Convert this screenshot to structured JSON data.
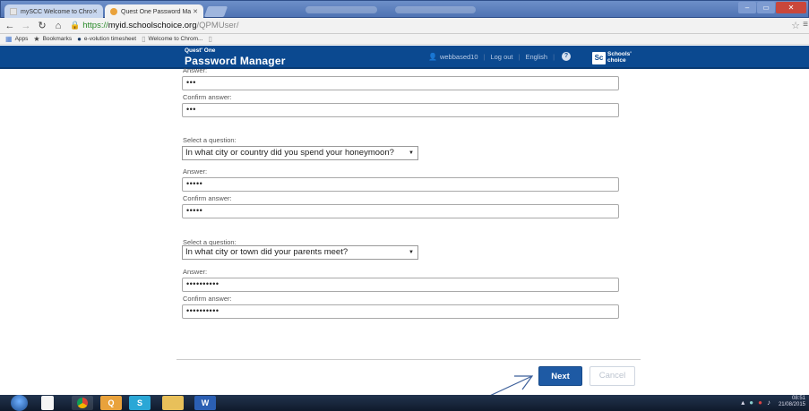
{
  "browser": {
    "tabs": [
      {
        "label": "mySCC Welcome to Chro",
        "active": false
      },
      {
        "label": "Quest One Password Ma",
        "active": true
      }
    ],
    "url": {
      "scheme": "https://",
      "host": "myid.schoolschoice.org",
      "path": "/QPMUser/"
    },
    "bookmarks": [
      {
        "label": "Apps",
        "icon": "apps-grid-icon"
      },
      {
        "label": "Bookmarks",
        "icon": "star-icon"
      },
      {
        "label": "e-volution timesheet",
        "icon": "evolution-icon"
      },
      {
        "label": "Welcome to Chrom...",
        "icon": "page-icon"
      }
    ]
  },
  "header": {
    "brand_small": "Quest' One",
    "brand_big": "Password Manager",
    "username": "webbased10",
    "logout": "Log out",
    "language": "English",
    "logo_box": "Sc",
    "logo_line1": "Schools'",
    "logo_line2": "choice",
    "accent_color": "#0b4990"
  },
  "form": {
    "group1": {
      "answer_label": "Answer:",
      "answer_value": "•••",
      "confirm_label": "Confirm answer:",
      "confirm_value": "•••"
    },
    "group2": {
      "question_label": "Select a question:",
      "question_value": "In what city or country did you spend your honeymoon?",
      "answer_label": "Answer:",
      "answer_value": "•••••",
      "confirm_label": "Confirm answer:",
      "confirm_value": "•••••"
    },
    "group3": {
      "question_label": "Select a question:",
      "question_value": "In what city or town did your parents meet?",
      "answer_label": "Answer:",
      "answer_value": "••••••••••",
      "confirm_label": "Confirm answer:",
      "confirm_value": "••••••••••"
    },
    "next_label": "Next",
    "cancel_label": "Cancel"
  },
  "taskbar": {
    "time": "08:51",
    "date": "21/08/2015"
  }
}
